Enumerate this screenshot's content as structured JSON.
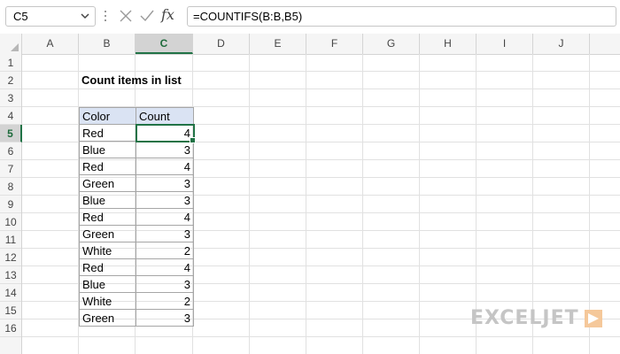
{
  "formula_bar": {
    "name_box": "C5",
    "fx_label": "fx",
    "formula": "=COUNTIFS(B:B,B5)"
  },
  "columns": [
    "A",
    "B",
    "C",
    "D",
    "E",
    "F",
    "G",
    "H",
    "I",
    "J"
  ],
  "selected_column": "C",
  "rows": [
    "1",
    "2",
    "3",
    "4",
    "5",
    "6",
    "7",
    "8",
    "9",
    "10",
    "11",
    "12",
    "13",
    "14",
    "15",
    "16"
  ],
  "selected_row": "5",
  "sheet": {
    "title": "Count items in list",
    "table": {
      "headers": [
        "Color",
        "Count"
      ],
      "rows": [
        [
          "Red",
          "4"
        ],
        [
          "Blue",
          "3"
        ],
        [
          "Red",
          "4"
        ],
        [
          "Green",
          "3"
        ],
        [
          "Blue",
          "3"
        ],
        [
          "Red",
          "4"
        ],
        [
          "Green",
          "3"
        ],
        [
          "White",
          "2"
        ],
        [
          "Red",
          "4"
        ],
        [
          "Blue",
          "3"
        ],
        [
          "White",
          "2"
        ],
        [
          "Green",
          "3"
        ]
      ]
    }
  },
  "brand": {
    "logo_text": "EXCELJET"
  },
  "colors": {
    "selection": "#217346",
    "header_fill": "#dae3f3",
    "logo": "#c5c5c5"
  }
}
